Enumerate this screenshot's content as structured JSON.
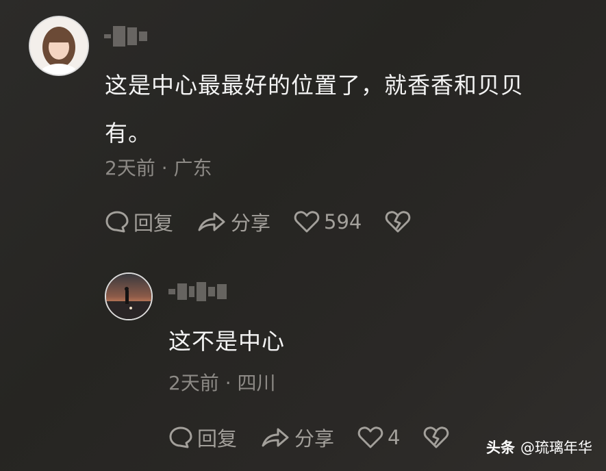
{
  "comment": {
    "text_line1": "这是中心最最好的位置了，就香香和贝贝",
    "text_line2": "有。",
    "meta": "2天前 · 广东",
    "reply_label": "回复",
    "share_label": "分享",
    "like_count": "594"
  },
  "reply": {
    "text": "这不是中心",
    "meta": "2天前 · 四川",
    "reply_label": "回复",
    "share_label": "分享",
    "like_count": "4"
  },
  "watermark": {
    "brand": "头条",
    "handle": "@琉璃年华"
  },
  "colors": {
    "background": "#2a2926",
    "action_gray": "#a3a09b",
    "meta_gray": "#8d8a86"
  },
  "icons": [
    "comment-icon",
    "share-icon",
    "heart-icon",
    "broken-heart-icon"
  ]
}
